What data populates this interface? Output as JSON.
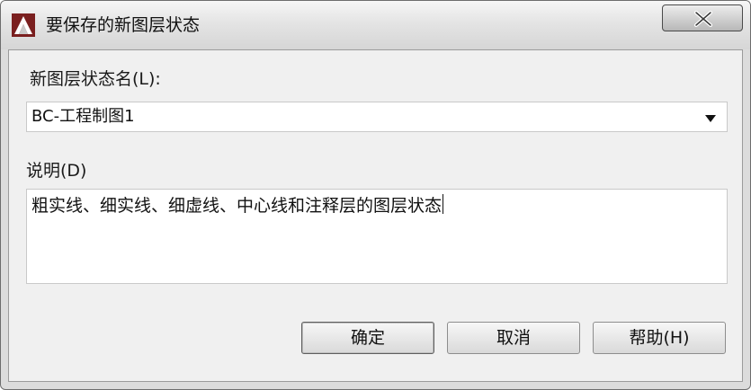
{
  "window": {
    "title": "要保存的新图层状态",
    "icon": "autocad-logo-icon",
    "close_glyph": "X"
  },
  "name_field": {
    "label": "新图层状态名(L):",
    "value": "BC-工程制图1"
  },
  "description_field": {
    "label": "说明(D)",
    "value": "粗实线、细实线、细虚线、中心线和注释层的图层状态"
  },
  "buttons": {
    "ok_label": "确定",
    "cancel_label": "取消",
    "help_label": "帮助(H)"
  }
}
